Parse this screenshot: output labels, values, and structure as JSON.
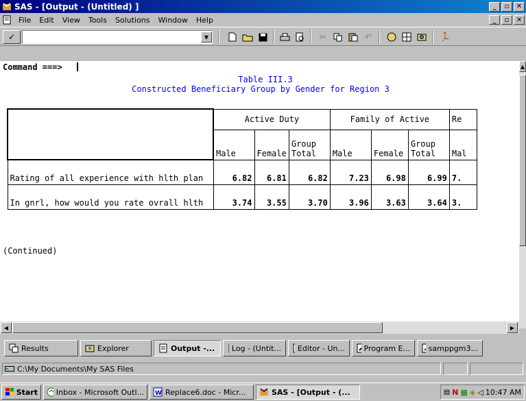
{
  "window": {
    "title": "SAS - [Output - (Untitled) ]"
  },
  "menu": [
    {
      "label": "File"
    },
    {
      "label": "Edit"
    },
    {
      "label": "View"
    },
    {
      "label": "Tools"
    },
    {
      "label": "Solutions"
    },
    {
      "label": "Window"
    },
    {
      "label": "Help"
    }
  ],
  "toolbar": {
    "check_glyph": "✓",
    "command_value": "",
    "icons": [
      "new-icon",
      "open-icon",
      "save-icon",
      "print-icon",
      "print-preview-icon",
      "cut-icon",
      "copy-icon",
      "paste-icon",
      "undo-icon",
      "help-icon",
      "library-icon",
      "explorer-icon",
      "run-icon"
    ]
  },
  "output": {
    "command_prompt": "Command ===>",
    "title_line1": "Table III.3",
    "title_line2": "Constructed Beneficiary Group by Gender for Region 3",
    "groups": [
      "Active Duty",
      "Family of Active",
      "Re"
    ],
    "subheaders": [
      "Male",
      "Female",
      "Group Total",
      "Male",
      "Female",
      "Group Total",
      "Mal"
    ],
    "rows": [
      {
        "label": "Rating of all experience with hlth plan",
        "values": [
          "6.82",
          "6.81",
          "6.82",
          "7.23",
          "6.98",
          "6.99",
          "7."
        ]
      },
      {
        "label": "In gnrl, how would you rate ovrall hlth",
        "values": [
          "3.74",
          "3.55",
          "3.70",
          "3.96",
          "3.63",
          "3.64",
          "3."
        ]
      }
    ],
    "continued": "(Continued)"
  },
  "tabs": [
    {
      "label": "Results",
      "icon": "results-icon",
      "active": false
    },
    {
      "label": "Explorer",
      "icon": "explorer-icon",
      "active": false
    },
    {
      "label": "Output -...",
      "icon": "output-icon",
      "active": true
    },
    {
      "label": "Log - (Untit...",
      "icon": "log-icon",
      "active": false
    },
    {
      "label": "Editor - Un...",
      "icon": "editor-icon",
      "active": false
    },
    {
      "label": "Program E...",
      "icon": "program-editor-icon",
      "active": false
    },
    {
      "label": "samppgm3...",
      "icon": "program-icon",
      "active": false
    }
  ],
  "status": {
    "path": "C:\\My Documents\\My SAS Files"
  },
  "taskbar": {
    "start": "Start",
    "items": [
      {
        "label": "Inbox - Microsoft Outl...",
        "icon": "outlook-icon"
      },
      {
        "label": "Replace6.doc - Micr...",
        "icon": "word-icon"
      },
      {
        "label": "SAS - [Output - (...",
        "icon": "sas-icon"
      }
    ],
    "clock": "10:47 AM"
  }
}
